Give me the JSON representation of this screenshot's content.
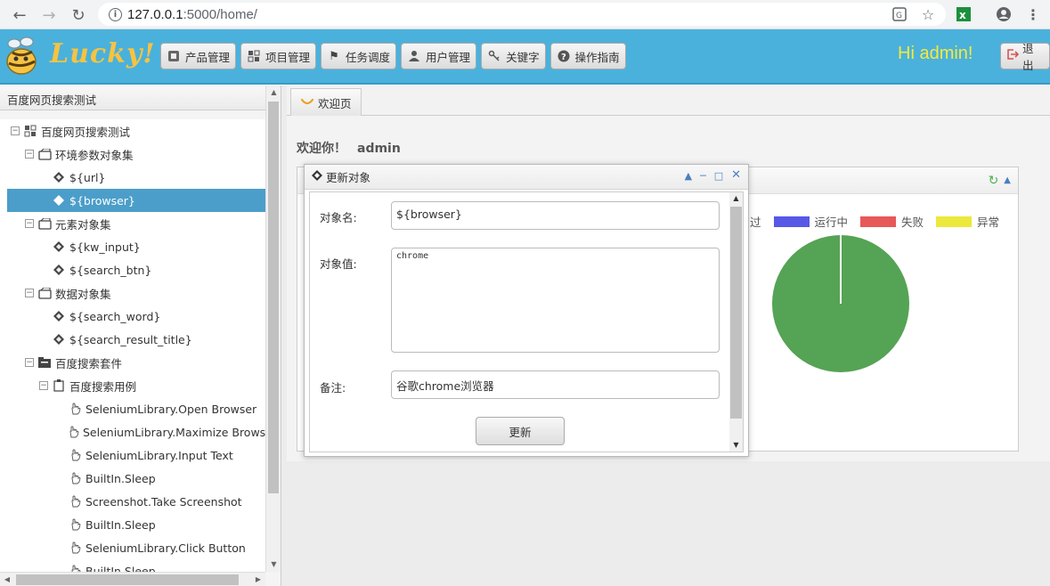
{
  "browser": {
    "url_host": "127.0.0.1",
    "url_path": ":5000/home/"
  },
  "header": {
    "logo_text": "Lucky!",
    "nav": [
      {
        "label": "产品管理",
        "icon": "product-icon"
      },
      {
        "label": "项目管理",
        "icon": "project-icon"
      },
      {
        "label": "任务调度",
        "icon": "flag-icon"
      },
      {
        "label": "用户管理",
        "icon": "user-icon"
      },
      {
        "label": "关键字",
        "icon": "key-icon"
      },
      {
        "label": "操作指南",
        "icon": "help-icon"
      }
    ],
    "greeting": "Hi admin!",
    "logout_label": "退出"
  },
  "sidebar": {
    "title": "百度网页搜索测试",
    "tree": [
      {
        "label": "百度网页搜索测试",
        "level": 0,
        "icon": "project-icon"
      },
      {
        "label": "环境参数对象集",
        "level": 1,
        "icon": "folder-box-icon"
      },
      {
        "label": "${url}",
        "level": 2,
        "icon": "object-icon"
      },
      {
        "label": "${browser}",
        "level": 2,
        "icon": "object-icon",
        "selected": true
      },
      {
        "label": "元素对象集",
        "level": 1,
        "icon": "folder-box-icon"
      },
      {
        "label": "${kw_input}",
        "level": 2,
        "icon": "object-icon"
      },
      {
        "label": "${search_btn}",
        "level": 2,
        "icon": "object-icon"
      },
      {
        "label": "数据对象集",
        "level": 1,
        "icon": "folder-box-icon"
      },
      {
        "label": "${search_word}",
        "level": 2,
        "icon": "object-icon"
      },
      {
        "label": "${search_result_title}",
        "level": 2,
        "icon": "object-icon"
      },
      {
        "label": "百度搜索套件",
        "level": 1,
        "icon": "suite-icon"
      },
      {
        "label": "百度搜索用例",
        "level": 2,
        "icon": "case-icon"
      },
      {
        "label": "SeleniumLibrary.Open Browser",
        "level": 3,
        "icon": "hand-icon"
      },
      {
        "label": "SeleniumLibrary.Maximize Browser W",
        "level": 3,
        "icon": "hand-icon"
      },
      {
        "label": "SeleniumLibrary.Input Text",
        "level": 3,
        "icon": "hand-icon"
      },
      {
        "label": "BuiltIn.Sleep",
        "level": 3,
        "icon": "hand-icon"
      },
      {
        "label": "Screenshot.Take Screenshot",
        "level": 3,
        "icon": "hand-icon"
      },
      {
        "label": "BuiltIn.Sleep",
        "level": 3,
        "icon": "hand-icon"
      },
      {
        "label": "SeleniumLibrary.Click Button",
        "level": 3,
        "icon": "hand-icon"
      },
      {
        "label": "BuiltIn.Sleep",
        "level": 3,
        "icon": "hand-icon"
      }
    ]
  },
  "main": {
    "tab_label": "欢迎页",
    "welcome_text": "欢迎你！",
    "welcome_user": "admin",
    "legend": [
      {
        "label": "过",
        "color": ""
      },
      {
        "label": "运行中",
        "color": "#5858e8"
      },
      {
        "label": "失败",
        "color": "#e85858"
      },
      {
        "label": "异常",
        "color": "#ece83c"
      }
    ],
    "pie_color": "#55a354"
  },
  "dialog": {
    "title": "更新对象",
    "name_label": "对象名:",
    "name_value": "${browser}",
    "value_label": "对象值:",
    "value_value": "chrome",
    "note_label": "备注:",
    "note_value": "谷歌chrome浏览器",
    "submit_label": "更新"
  }
}
